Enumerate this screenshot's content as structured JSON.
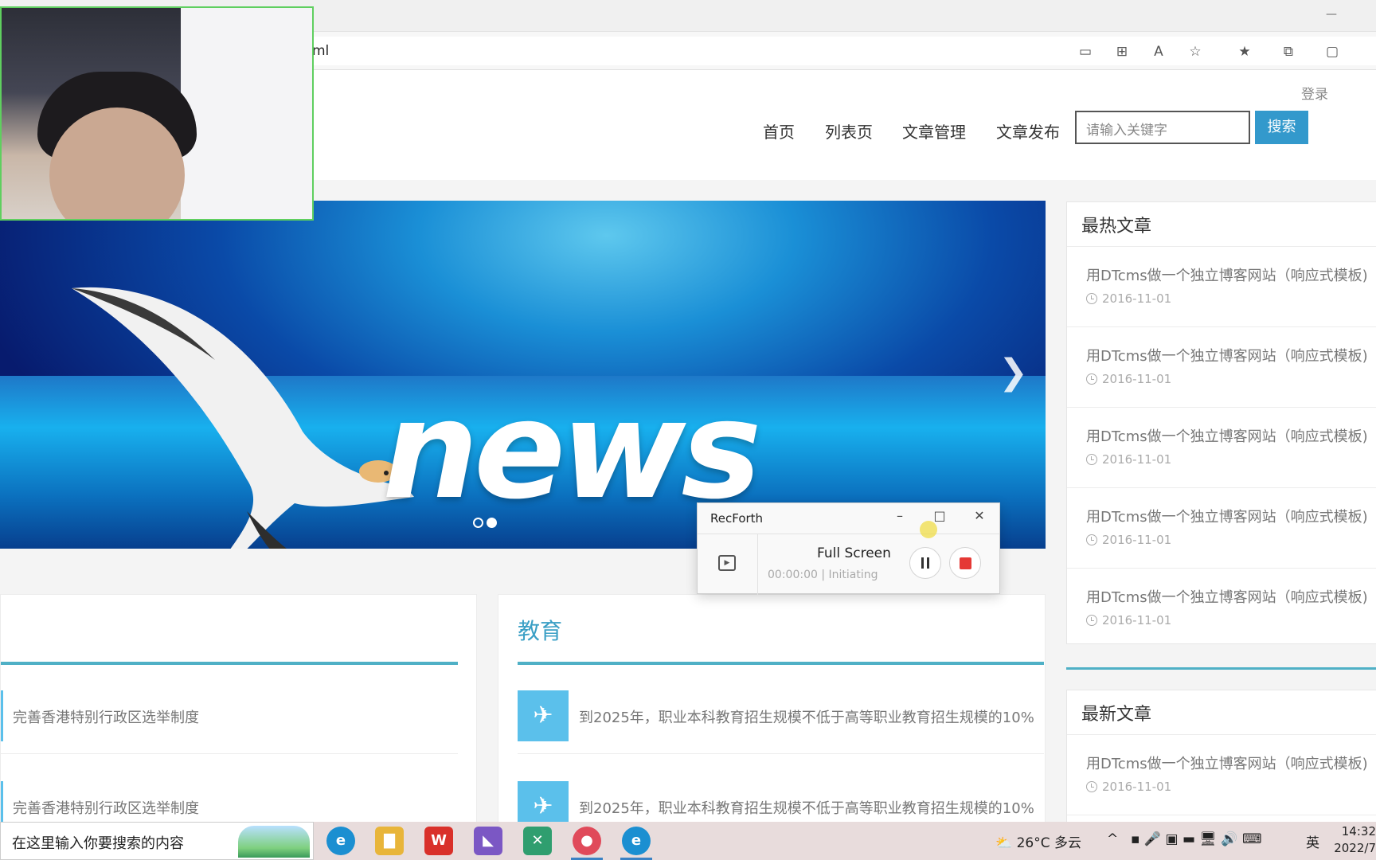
{
  "browser": {
    "address_fragment": "ml",
    "minimize_glyph": "—"
  },
  "header": {
    "login": "登录",
    "nav": [
      "首页",
      "列表页",
      "文章管理",
      "文章发布"
    ],
    "search_placeholder": "请输入关键字",
    "search_button": "搜索"
  },
  "banner": {
    "word": "news",
    "slides": 2,
    "active_slide": 2
  },
  "hot_panel": {
    "title": "最热文章",
    "items": [
      {
        "title": "用DTcms做一个独立博客网站（响应式模板)",
        "date": "2016-11-01"
      },
      {
        "title": "用DTcms做一个独立博客网站（响应式模板)",
        "date": "2016-11-01"
      },
      {
        "title": "用DTcms做一个独立博客网站（响应式模板)",
        "date": "2016-11-01"
      },
      {
        "title": "用DTcms做一个独立博客网站（响应式模板)",
        "date": "2016-11-01"
      },
      {
        "title": "用DTcms做一个独立博客网站（响应式模板)",
        "date": "2016-11-01"
      }
    ]
  },
  "new_panel": {
    "title": "最新文章",
    "items": [
      {
        "title": "用DTcms做一个独立博客网站（响应式模板)",
        "date": "2016-11-01"
      }
    ]
  },
  "left_column": {
    "items": [
      "完善香港特别行政区选举制度",
      "完善香港特别行政区选举制度"
    ]
  },
  "edu_column": {
    "title": "教育",
    "items": [
      "到2025年，职业本科教育招生规模不低于高等职业教育招生规模的10%",
      "到2025年，职业本科教育招生规模不低于高等职业教育招生规模的10%"
    ]
  },
  "recorder": {
    "app_name": "RecForth",
    "mode": "Full Screen",
    "time": "00:00:00",
    "status": "Initiating"
  },
  "taskbar": {
    "search_text": "在这里输入你要搜索的内容",
    "weather": "26°C 多云",
    "ime": "英",
    "time": "14:32",
    "date": "2022/7"
  }
}
